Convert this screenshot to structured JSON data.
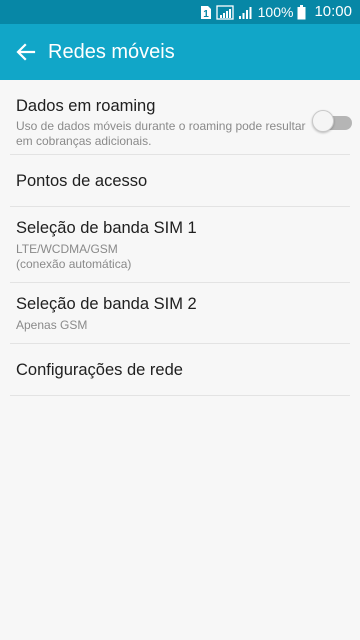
{
  "status_bar": {
    "sim_badge": "1",
    "battery_percent": "100%",
    "time": "10:00",
    "icons": [
      "sim-1-icon",
      "signal-icon",
      "signal-icon-2",
      "battery-icon"
    ]
  },
  "app_bar": {
    "back_icon": "arrow-left-icon",
    "title": "Redes móveis"
  },
  "settings": {
    "items": [
      {
        "title": "Dados em roaming",
        "subtitle": "Uso de dados móveis durante o roaming pode resultar em cobranças adicionais.",
        "toggle": "off"
      },
      {
        "title": "Pontos de acesso"
      },
      {
        "title": "Seleção de banda SIM 1",
        "subtitle": "LTE/WCDMA/GSM\n(conexão automática)"
      },
      {
        "title": "Seleção de banda SIM 2",
        "subtitle": "Apenas GSM"
      },
      {
        "title": "Configurações de rede"
      }
    ]
  },
  "colors": {
    "status_bar": "#0787a6",
    "app_bar": "#11a6c8",
    "background": "#f7f7f7"
  }
}
